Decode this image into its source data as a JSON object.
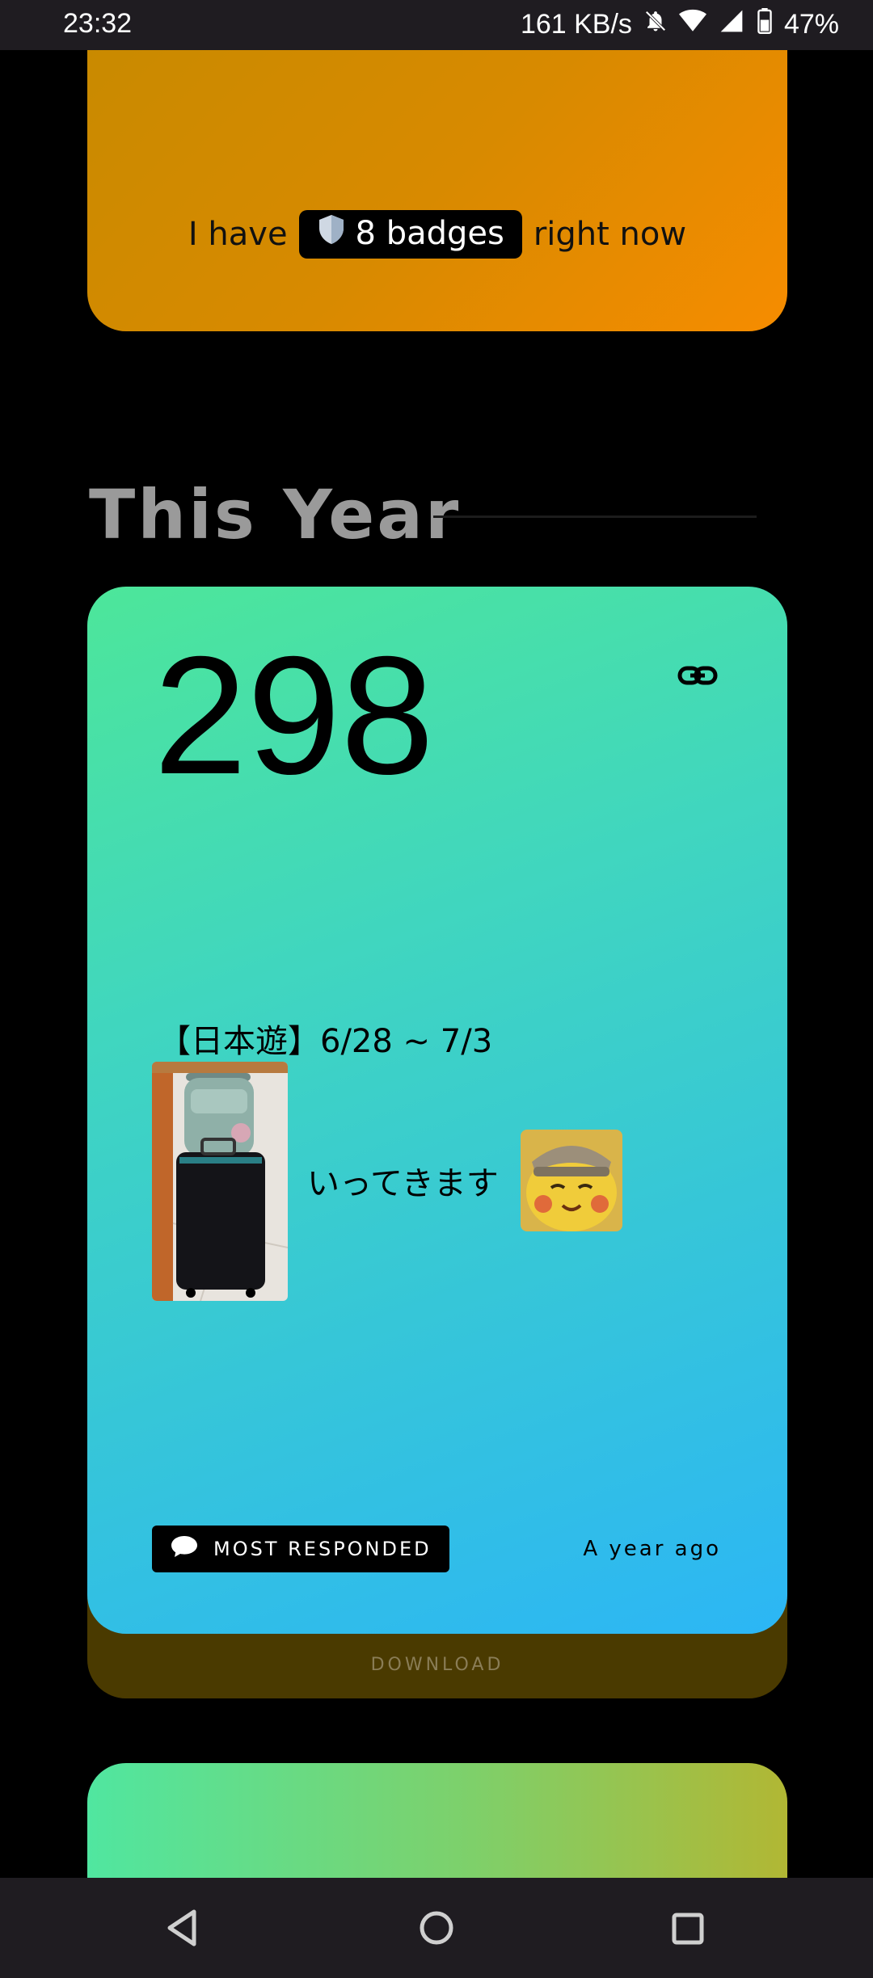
{
  "status_bar": {
    "time": "23:32",
    "speed": "161 KB/s",
    "battery": "47%"
  },
  "badges": {
    "prefix": "I have",
    "pill_label": "8 badges",
    "suffix": "right now",
    "icon": "shield-icon"
  },
  "section": {
    "title": "This Year"
  },
  "card": {
    "count": "298",
    "post_title": "【日本遊】6/28 ~ 7/3",
    "post_text": "いってきます",
    "tag_label": "MOST RESPONDED",
    "time_ago": "A year ago",
    "link_icon": "link-icon"
  },
  "download": {
    "label": "DOWNLOAD"
  },
  "colors": {
    "orange_start": "#c98a00",
    "orange_end": "#f68c00",
    "card_start": "#4de69a",
    "card_end": "#2cb6f5"
  }
}
